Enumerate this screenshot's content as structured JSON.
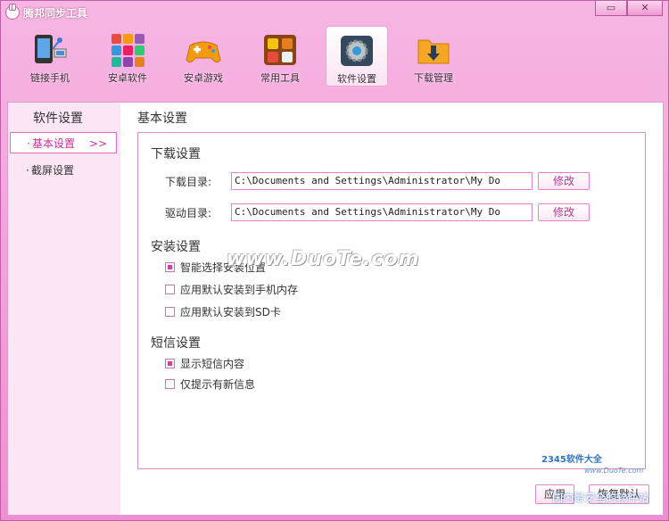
{
  "app": {
    "title": "腾邦同步工具"
  },
  "window_controls": {
    "minimize": "▭",
    "close": "✕"
  },
  "toolbar": [
    {
      "id": "phone",
      "label": "链接手机",
      "icon": "phone-connect-icon"
    },
    {
      "id": "software",
      "label": "安卓软件",
      "icon": "app-grid-icon"
    },
    {
      "id": "games",
      "label": "安卓游戏",
      "icon": "gamepad-icon"
    },
    {
      "id": "tools",
      "label": "常用工具",
      "icon": "toolbox-icon"
    },
    {
      "id": "settings",
      "label": "软件设置",
      "icon": "gear-icon",
      "active": true
    },
    {
      "id": "download",
      "label": "下载管理",
      "icon": "download-folder-icon"
    }
  ],
  "sidebar": {
    "title": "软件设置",
    "items": [
      {
        "label": "基本设置",
        "bullet": "·",
        "arrow": ">>",
        "active": true
      },
      {
        "label": "截屏设置",
        "bullet": "·",
        "active": false
      }
    ]
  },
  "main": {
    "title": "基本设置",
    "download": {
      "title": "下载设置",
      "dir_label": "下载目录:",
      "dir_value": "C:\\Documents and Settings\\Administrator\\My Do",
      "driver_label": "驱动目录:",
      "driver_value": "C:\\Documents and Settings\\Administrator\\My Do",
      "modify": "修改"
    },
    "install": {
      "title": "安装设置",
      "options": [
        {
          "label": "智能选择安装位置",
          "checked": true
        },
        {
          "label": "应用默认安装到手机内存",
          "checked": false
        },
        {
          "label": "应用默认安装到SD卡",
          "checked": false
        }
      ]
    },
    "sms": {
      "title": "短信设置",
      "options": [
        {
          "label": "显示短信内容",
          "checked": true
        },
        {
          "label": "仅提示有新信息",
          "checked": false
        }
      ]
    }
  },
  "watermark": "www.DuoTe.com",
  "buttons": {
    "apply": "应用",
    "restore": "恢复默认"
  },
  "overlay_logo": {
    "brand": "2345软件大全",
    "url": "www.DuoTe.com",
    "site": "国内最安全的软件站"
  },
  "colors": {
    "accent": "#d02c9f",
    "frame": "#ef8fd3",
    "border": "#e77fcb"
  }
}
